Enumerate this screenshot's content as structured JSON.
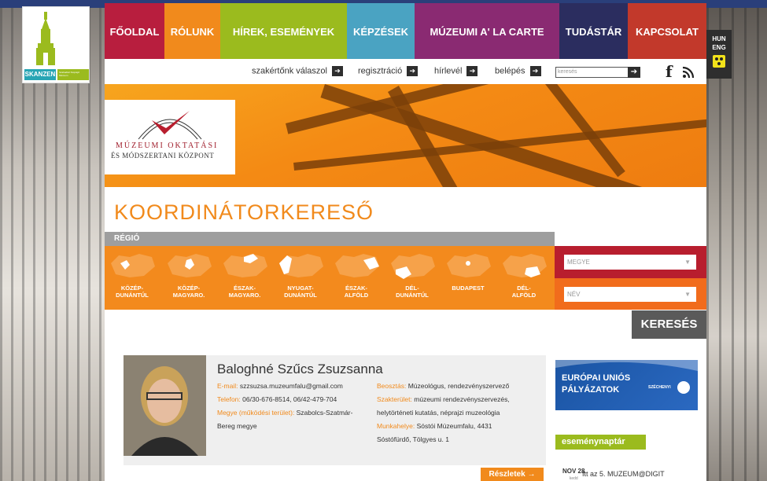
{
  "colors": {
    "orange": "#f18a1c",
    "red": "#b81e2e",
    "grey": "#9e9e9e",
    "dark": "#2e2e2e",
    "green": "#9bbb1e"
  },
  "logo": {
    "brand": "SKANZEN",
    "brand_sub": "Szabadtéri Néprajzi Múzeum"
  },
  "nav": {
    "items": [
      {
        "label": "FŐOLDAL",
        "color": "#b81e3e"
      },
      {
        "label": "RÓLUNK",
        "color": "#f18a1c"
      },
      {
        "label": "HÍREK, ESEMÉNYEK",
        "color": "#9bbb1e"
      },
      {
        "label": "KÉPZÉSEK",
        "color": "#4aa3c2"
      },
      {
        "label": "MÚZEUMI A' LA CARTE",
        "color": "#8a2a72"
      },
      {
        "label": "TUDÁSTÁR",
        "color": "#2b2d5f"
      },
      {
        "label": "KAPCSOLAT",
        "color": "#c2392b"
      }
    ],
    "lang_hu": "HUN",
    "lang_en": "ENG"
  },
  "util": {
    "expert": "szakértőnk válaszol",
    "register": "regisztráció",
    "newsletter": "hírlevél",
    "login": "belépés",
    "search_placeholder": "keresés"
  },
  "banner": {
    "org_line1": "MÚZEUMI OKTATÁSI",
    "org_line2": "ÉS MÓDSZERTANI KÖZPONT"
  },
  "page_title": "KOORDINÁTORKERESŐ",
  "region_header": "RÉGIÓ",
  "regions": [
    {
      "line1": "KÖZÉP-",
      "line2": "DUNÁNTÚL"
    },
    {
      "line1": "KÖZÉP-",
      "line2": "MAGYARO."
    },
    {
      "line1": "ÉSZAK-",
      "line2": "MAGYARO."
    },
    {
      "line1": "NYUGAT-",
      "line2": "DUNÁNTÚL"
    },
    {
      "line1": "ÉSZAK-",
      "line2": "ALFÖLD"
    },
    {
      "line1": "DÉL-",
      "line2": "DUNÁNTÚL"
    },
    {
      "line1": "BUDAPEST",
      "line2": ""
    },
    {
      "line1": "DÉL-",
      "line2": "ALFÖLD"
    }
  ],
  "filters": {
    "county": "MEGYE",
    "name": "NÉV"
  },
  "search_button": "KERESÉS",
  "profile": {
    "name": "Baloghné Szűcs Zsuzsanna",
    "email_key": "E-mail:",
    "email": "szzsuzsa.muzeumfalu@gmail.com",
    "phone_key": "Telefon:",
    "phone": "06/30-676-8514, 06/42-479-704",
    "county_key": "Megye (működési terület):",
    "county_val1": "Szabolcs-Szatmár-",
    "county_val2": "Bereg megye",
    "position_key": "Beosztás:",
    "position": "Múzeológus, rendezvényszervező",
    "field_key": "Szakterület:",
    "field1": "múzeumi rendezvényszervezés,",
    "field2": "helytörténeti kutatás, néprajzi muzeológia",
    "work_key": "Munkahelye:",
    "work1": "Sóstói Múzeumfalu, 4431",
    "work2": "Sóstófürdő, Tölgyes u. 1",
    "details": "Részletek →"
  },
  "eu": {
    "line1": "EURÓPAI UNIÓS",
    "line2": "PÁLYÁZATOK",
    "brand": "SZÉCHENYI"
  },
  "events": {
    "header": "eseménynaptár",
    "date": "NOV 28",
    "weekday": "kedd",
    "text": "Itt az 5. MUZEUM@DIGIT"
  }
}
